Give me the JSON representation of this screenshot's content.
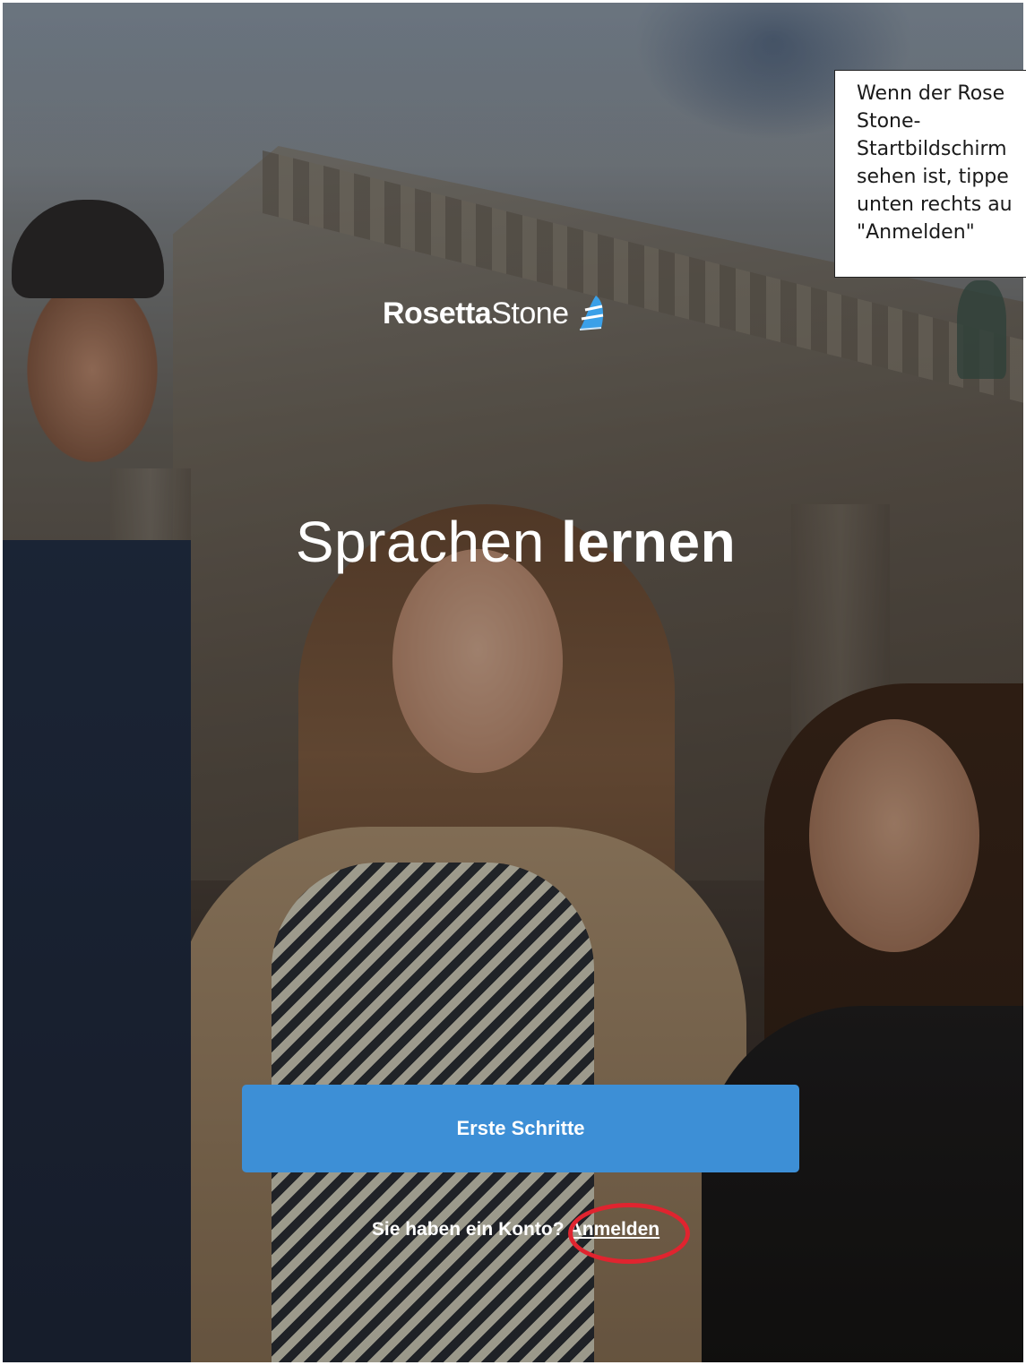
{
  "app": {
    "logo_bold": "Rosetta",
    "logo_light": "Stone",
    "headline_thin": "Sprachen",
    "headline_bold": "lernen"
  },
  "cta": {
    "label": "Erste Schritte"
  },
  "login": {
    "prompt": "Sie haben ein Konto?",
    "link_label": "Anmelden"
  },
  "callout": {
    "text": "Wenn der Rose\nStone-\nStartbildschirm \nsehen ist, tippe\nunten rechts au\n\"Anmelden\""
  },
  "colors": {
    "button": "#3d8fd6",
    "highlight": "#e0242f",
    "logo_icon": "#3aa0e8"
  },
  "icons": {
    "logo_icon": "rosetta-stone-sail-icon"
  }
}
